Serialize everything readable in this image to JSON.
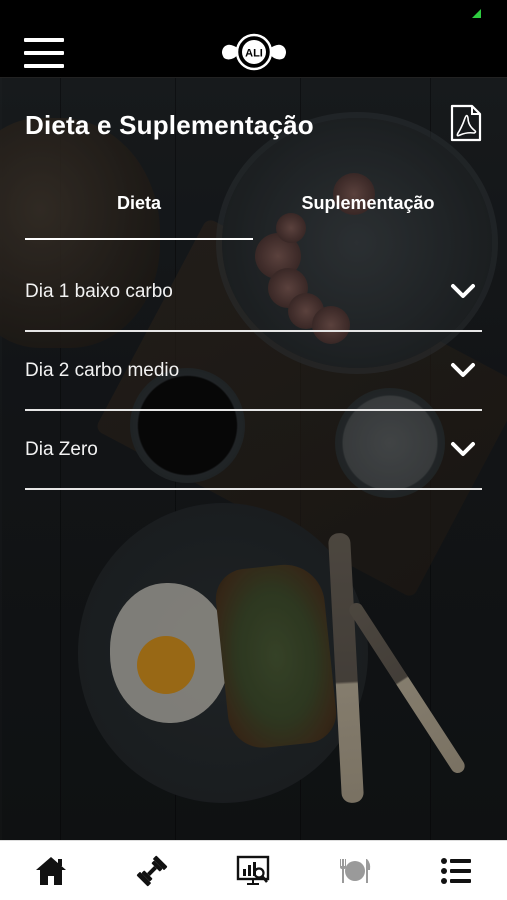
{
  "header": {
    "logo_text": "ALI"
  },
  "page": {
    "title": "Dieta e Suplementação"
  },
  "tabs": [
    {
      "label": "Dieta",
      "active": true
    },
    {
      "label": "Suplementação",
      "active": false
    }
  ],
  "accordion": [
    {
      "label": "Dia 1 baixo carbo"
    },
    {
      "label": "Dia 2 carbo medio"
    },
    {
      "label": "Dia Zero"
    }
  ],
  "bottom_nav": [
    {
      "icon": "home-icon",
      "active": false
    },
    {
      "icon": "dumbbell-icon",
      "active": false
    },
    {
      "icon": "chart-presentation-icon",
      "active": false
    },
    {
      "icon": "plate-cutlery-icon",
      "active": true
    },
    {
      "icon": "list-icon",
      "active": false
    }
  ],
  "colors": {
    "header_bg": "#000000",
    "nav_bg": "#ffffff",
    "nav_icon": "#111111",
    "nav_icon_active": "#9a9a9a",
    "divider": "#e6e6e6",
    "status_indicator": "#2ecc40"
  }
}
